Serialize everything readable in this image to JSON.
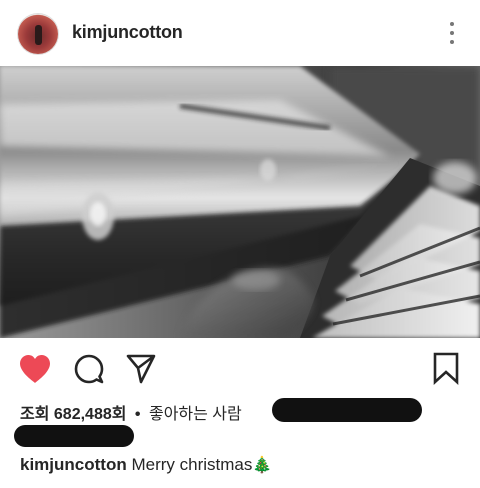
{
  "post": {
    "username": "kimjuncotton",
    "views_label": "조회",
    "views_count": "682,488회",
    "bullet": "•",
    "likes_text": "좋아하는 사람",
    "caption_user": "kimjuncotton",
    "caption_text": "Merry christmas",
    "caption_emoji": "🎄"
  },
  "icons": {
    "more": "more-vertical-icon",
    "like": "heart-icon",
    "comment": "comment-icon",
    "share": "paper-plane-icon",
    "save": "bookmark-icon"
  },
  "colors": {
    "like_active": "#ed4956",
    "text": "#262626",
    "icon_stroke": "#262626"
  }
}
